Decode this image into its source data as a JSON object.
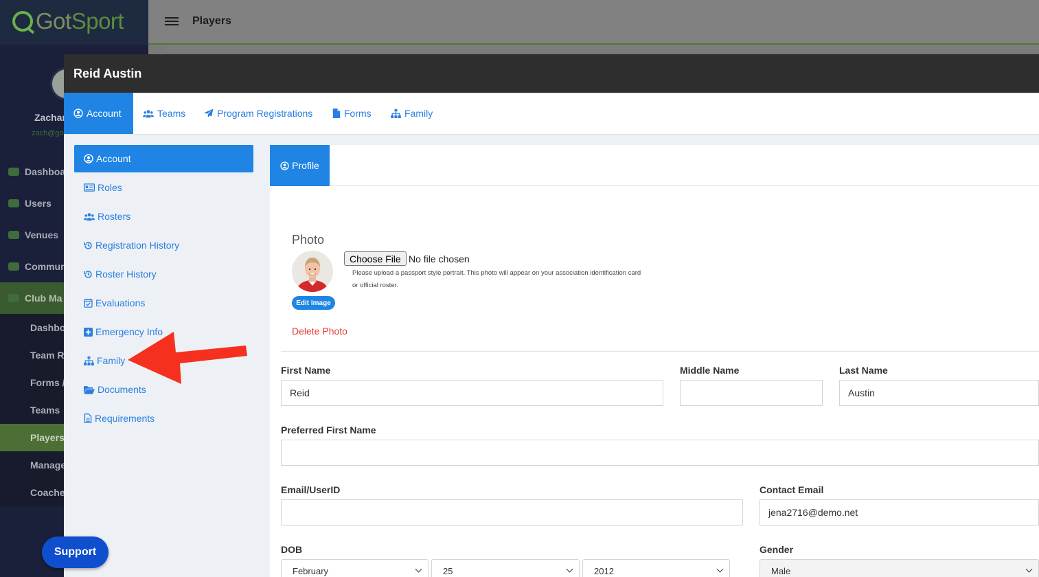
{
  "app": {
    "logo_got": "Got",
    "logo_sport": "Sport",
    "topbar_title": "Players",
    "user_name": "Zachar",
    "user_email": "zach@go",
    "sidebar": [
      {
        "label": "Dashboa"
      },
      {
        "label": "Users"
      },
      {
        "label": "Venues"
      },
      {
        "label": "Commun"
      },
      {
        "label": "Club Ma"
      }
    ],
    "sidebar_sub": [
      {
        "label": "Dashbo"
      },
      {
        "label": "Team R"
      },
      {
        "label": "Forms /"
      },
      {
        "label": "Teams"
      },
      {
        "label": "Players"
      },
      {
        "label": "Manage"
      },
      {
        "label": "Coache"
      }
    ],
    "support_label": "Support"
  },
  "modal": {
    "title": "Reid Austin",
    "tabs": [
      {
        "label": "Account",
        "icon": "user-circle-icon"
      },
      {
        "label": "Teams",
        "icon": "users-icon"
      },
      {
        "label": "Program Registrations",
        "icon": "paper-plane-icon"
      },
      {
        "label": "Forms",
        "icon": "file-icon"
      },
      {
        "label": "Family",
        "icon": "sitemap-icon"
      }
    ],
    "left_nav": [
      {
        "label": "Account",
        "icon": "user-circle-icon"
      },
      {
        "label": "Roles",
        "icon": "id-card-icon"
      },
      {
        "label": "Rosters",
        "icon": "users-icon"
      },
      {
        "label": "Registration History",
        "icon": "history-icon"
      },
      {
        "label": "Roster History",
        "icon": "history-icon"
      },
      {
        "label": "Evaluations",
        "icon": "calendar-check-icon"
      },
      {
        "label": "Emergency Info",
        "icon": "plus-square-icon"
      },
      {
        "label": "Family",
        "icon": "sitemap-icon"
      },
      {
        "label": "Documents",
        "icon": "folder-open-icon"
      },
      {
        "label": "Requirements",
        "icon": "file-text-icon"
      }
    ],
    "profile_tab": "Profile",
    "photo": {
      "label": "Photo",
      "choose_file": "Choose File",
      "no_file": "No file chosen",
      "help_line_1": "Please upload a passport style portrait. This photo will appear on your association identification card",
      "help_line_2": "or official roster.",
      "edit_image": "Edit Image",
      "delete_photo": "Delete Photo"
    },
    "form": {
      "first_name": {
        "label": "First Name",
        "value": "Reid"
      },
      "middle_name": {
        "label": "Middle Name",
        "value": ""
      },
      "last_name": {
        "label": "Last Name",
        "value": "Austin"
      },
      "preferred_first_name": {
        "label": "Preferred First Name",
        "value": ""
      },
      "email_userid": {
        "label": "Email/UserID",
        "value": ""
      },
      "contact_email": {
        "label": "Contact Email",
        "value": "jena2716@demo.net"
      },
      "dob": {
        "label": "DOB",
        "month": "February",
        "day": "25",
        "year": "2012"
      },
      "gender": {
        "label": "Gender",
        "value": "Male"
      }
    }
  },
  "colors": {
    "primary_blue": "#1f84e4",
    "link_blue": "#2a7de1",
    "delete_red": "#e53e3e",
    "annotation_arrow": "#f5301e",
    "support_blue": "#0f4fcd"
  }
}
